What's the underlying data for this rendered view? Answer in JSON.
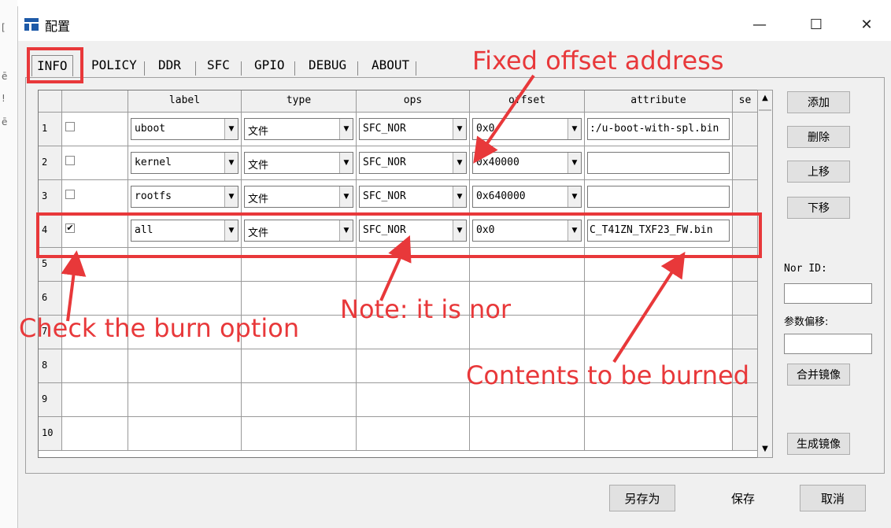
{
  "window": {
    "title": "配置",
    "minimize": "—",
    "maximize": "☐",
    "close": "✕"
  },
  "background_left": [
    "[",
    "ē",
    "!",
    "ē"
  ],
  "tabs": [
    "INFO",
    "POLICY",
    "DDR",
    "SFC",
    "GPIO",
    "DEBUG",
    "ABOUT"
  ],
  "table": {
    "headers": [
      "label",
      "type",
      "ops",
      "offset",
      "attribute",
      "se"
    ],
    "rows": [
      {
        "num": "1",
        "checked": false,
        "label": "uboot",
        "type": "文件",
        "ops": "SFC_NOR",
        "offset": "0x0",
        "attribute": ":/u-boot-with-spl.bin"
      },
      {
        "num": "2",
        "checked": false,
        "label": "kernel",
        "type": "文件",
        "ops": "SFC_NOR",
        "offset": "0x40000",
        "attribute": ""
      },
      {
        "num": "3",
        "checked": false,
        "label": "rootfs",
        "type": "文件",
        "ops": "SFC_NOR",
        "offset": "0x640000",
        "attribute": ""
      },
      {
        "num": "4",
        "checked": true,
        "label": "all",
        "type": "文件",
        "ops": "SFC_NOR",
        "offset": "0x0",
        "attribute": "C_T41ZN_TXF23_FW.bin"
      },
      {
        "num": "5"
      },
      {
        "num": "6"
      },
      {
        "num": "7"
      },
      {
        "num": "8"
      },
      {
        "num": "9"
      },
      {
        "num": "10"
      }
    ]
  },
  "side": {
    "add": "添加",
    "delete": "删除",
    "up": "上移",
    "down": "下移",
    "nor_id_label": "Nor ID:",
    "param_offset_label": "参数偏移:",
    "merge": "合并镜像",
    "generate": "生成镜像"
  },
  "bottom": {
    "save_as": "另存为",
    "save": "保存",
    "cancel": "取消"
  },
  "annotations": {
    "fixed_offset": "Fixed offset address",
    "check_burn": "Check the burn option",
    "note_nor": "Note: it is nor",
    "contents": "Contents to be burned",
    "color": "#e8383a"
  }
}
